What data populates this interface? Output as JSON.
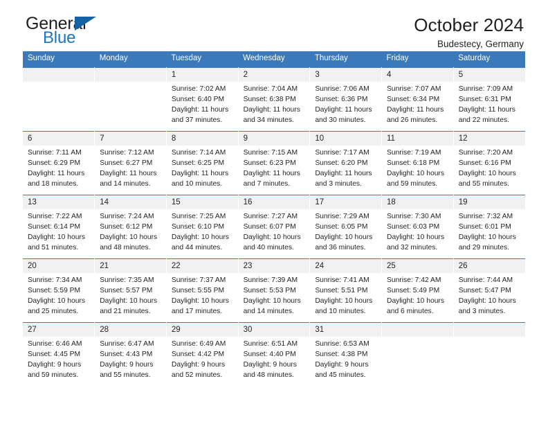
{
  "brand": {
    "name_top": "General",
    "name_bottom": "Blue",
    "accent_color": "#1b76bb",
    "triangle_color": "#1362a4"
  },
  "header": {
    "title": "October 2024",
    "subtitle": "Budestecy, Germany"
  },
  "colors": {
    "header_bar": "#3b79bb",
    "daynum_band": "#f1f1f1",
    "text": "#231f20"
  },
  "weekday_headers": [
    "Sunday",
    "Monday",
    "Tuesday",
    "Wednesday",
    "Thursday",
    "Friday",
    "Saturday"
  ],
  "weeks": [
    [
      {
        "day": "",
        "sunrise": "",
        "sunset": "",
        "daylight_line1": "",
        "daylight_line2": ""
      },
      {
        "day": "",
        "sunrise": "",
        "sunset": "",
        "daylight_line1": "",
        "daylight_line2": ""
      },
      {
        "day": "1",
        "sunrise": "Sunrise: 7:02 AM",
        "sunset": "Sunset: 6:40 PM",
        "daylight_line1": "Daylight: 11 hours",
        "daylight_line2": "and 37 minutes."
      },
      {
        "day": "2",
        "sunrise": "Sunrise: 7:04 AM",
        "sunset": "Sunset: 6:38 PM",
        "daylight_line1": "Daylight: 11 hours",
        "daylight_line2": "and 34 minutes."
      },
      {
        "day": "3",
        "sunrise": "Sunrise: 7:06 AM",
        "sunset": "Sunset: 6:36 PM",
        "daylight_line1": "Daylight: 11 hours",
        "daylight_line2": "and 30 minutes."
      },
      {
        "day": "4",
        "sunrise": "Sunrise: 7:07 AM",
        "sunset": "Sunset: 6:34 PM",
        "daylight_line1": "Daylight: 11 hours",
        "daylight_line2": "and 26 minutes."
      },
      {
        "day": "5",
        "sunrise": "Sunrise: 7:09 AM",
        "sunset": "Sunset: 6:31 PM",
        "daylight_line1": "Daylight: 11 hours",
        "daylight_line2": "and 22 minutes."
      }
    ],
    [
      {
        "day": "6",
        "sunrise": "Sunrise: 7:11 AM",
        "sunset": "Sunset: 6:29 PM",
        "daylight_line1": "Daylight: 11 hours",
        "daylight_line2": "and 18 minutes."
      },
      {
        "day": "7",
        "sunrise": "Sunrise: 7:12 AM",
        "sunset": "Sunset: 6:27 PM",
        "daylight_line1": "Daylight: 11 hours",
        "daylight_line2": "and 14 minutes."
      },
      {
        "day": "8",
        "sunrise": "Sunrise: 7:14 AM",
        "sunset": "Sunset: 6:25 PM",
        "daylight_line1": "Daylight: 11 hours",
        "daylight_line2": "and 10 minutes."
      },
      {
        "day": "9",
        "sunrise": "Sunrise: 7:15 AM",
        "sunset": "Sunset: 6:23 PM",
        "daylight_line1": "Daylight: 11 hours",
        "daylight_line2": "and 7 minutes."
      },
      {
        "day": "10",
        "sunrise": "Sunrise: 7:17 AM",
        "sunset": "Sunset: 6:20 PM",
        "daylight_line1": "Daylight: 11 hours",
        "daylight_line2": "and 3 minutes."
      },
      {
        "day": "11",
        "sunrise": "Sunrise: 7:19 AM",
        "sunset": "Sunset: 6:18 PM",
        "daylight_line1": "Daylight: 10 hours",
        "daylight_line2": "and 59 minutes."
      },
      {
        "day": "12",
        "sunrise": "Sunrise: 7:20 AM",
        "sunset": "Sunset: 6:16 PM",
        "daylight_line1": "Daylight: 10 hours",
        "daylight_line2": "and 55 minutes."
      }
    ],
    [
      {
        "day": "13",
        "sunrise": "Sunrise: 7:22 AM",
        "sunset": "Sunset: 6:14 PM",
        "daylight_line1": "Daylight: 10 hours",
        "daylight_line2": "and 51 minutes."
      },
      {
        "day": "14",
        "sunrise": "Sunrise: 7:24 AM",
        "sunset": "Sunset: 6:12 PM",
        "daylight_line1": "Daylight: 10 hours",
        "daylight_line2": "and 48 minutes."
      },
      {
        "day": "15",
        "sunrise": "Sunrise: 7:25 AM",
        "sunset": "Sunset: 6:10 PM",
        "daylight_line1": "Daylight: 10 hours",
        "daylight_line2": "and 44 minutes."
      },
      {
        "day": "16",
        "sunrise": "Sunrise: 7:27 AM",
        "sunset": "Sunset: 6:07 PM",
        "daylight_line1": "Daylight: 10 hours",
        "daylight_line2": "and 40 minutes."
      },
      {
        "day": "17",
        "sunrise": "Sunrise: 7:29 AM",
        "sunset": "Sunset: 6:05 PM",
        "daylight_line1": "Daylight: 10 hours",
        "daylight_line2": "and 36 minutes."
      },
      {
        "day": "18",
        "sunrise": "Sunrise: 7:30 AM",
        "sunset": "Sunset: 6:03 PM",
        "daylight_line1": "Daylight: 10 hours",
        "daylight_line2": "and 32 minutes."
      },
      {
        "day": "19",
        "sunrise": "Sunrise: 7:32 AM",
        "sunset": "Sunset: 6:01 PM",
        "daylight_line1": "Daylight: 10 hours",
        "daylight_line2": "and 29 minutes."
      }
    ],
    [
      {
        "day": "20",
        "sunrise": "Sunrise: 7:34 AM",
        "sunset": "Sunset: 5:59 PM",
        "daylight_line1": "Daylight: 10 hours",
        "daylight_line2": "and 25 minutes."
      },
      {
        "day": "21",
        "sunrise": "Sunrise: 7:35 AM",
        "sunset": "Sunset: 5:57 PM",
        "daylight_line1": "Daylight: 10 hours",
        "daylight_line2": "and 21 minutes."
      },
      {
        "day": "22",
        "sunrise": "Sunrise: 7:37 AM",
        "sunset": "Sunset: 5:55 PM",
        "daylight_line1": "Daylight: 10 hours",
        "daylight_line2": "and 17 minutes."
      },
      {
        "day": "23",
        "sunrise": "Sunrise: 7:39 AM",
        "sunset": "Sunset: 5:53 PM",
        "daylight_line1": "Daylight: 10 hours",
        "daylight_line2": "and 14 minutes."
      },
      {
        "day": "24",
        "sunrise": "Sunrise: 7:41 AM",
        "sunset": "Sunset: 5:51 PM",
        "daylight_line1": "Daylight: 10 hours",
        "daylight_line2": "and 10 minutes."
      },
      {
        "day": "25",
        "sunrise": "Sunrise: 7:42 AM",
        "sunset": "Sunset: 5:49 PM",
        "daylight_line1": "Daylight: 10 hours",
        "daylight_line2": "and 6 minutes."
      },
      {
        "day": "26",
        "sunrise": "Sunrise: 7:44 AM",
        "sunset": "Sunset: 5:47 PM",
        "daylight_line1": "Daylight: 10 hours",
        "daylight_line2": "and 3 minutes."
      }
    ],
    [
      {
        "day": "27",
        "sunrise": "Sunrise: 6:46 AM",
        "sunset": "Sunset: 4:45 PM",
        "daylight_line1": "Daylight: 9 hours",
        "daylight_line2": "and 59 minutes."
      },
      {
        "day": "28",
        "sunrise": "Sunrise: 6:47 AM",
        "sunset": "Sunset: 4:43 PM",
        "daylight_line1": "Daylight: 9 hours",
        "daylight_line2": "and 55 minutes."
      },
      {
        "day": "29",
        "sunrise": "Sunrise: 6:49 AM",
        "sunset": "Sunset: 4:42 PM",
        "daylight_line1": "Daylight: 9 hours",
        "daylight_line2": "and 52 minutes."
      },
      {
        "day": "30",
        "sunrise": "Sunrise: 6:51 AM",
        "sunset": "Sunset: 4:40 PM",
        "daylight_line1": "Daylight: 9 hours",
        "daylight_line2": "and 48 minutes."
      },
      {
        "day": "31",
        "sunrise": "Sunrise: 6:53 AM",
        "sunset": "Sunset: 4:38 PM",
        "daylight_line1": "Daylight: 9 hours",
        "daylight_line2": "and 45 minutes."
      },
      {
        "day": "",
        "sunrise": "",
        "sunset": "",
        "daylight_line1": "",
        "daylight_line2": ""
      },
      {
        "day": "",
        "sunrise": "",
        "sunset": "",
        "daylight_line1": "",
        "daylight_line2": ""
      }
    ]
  ]
}
